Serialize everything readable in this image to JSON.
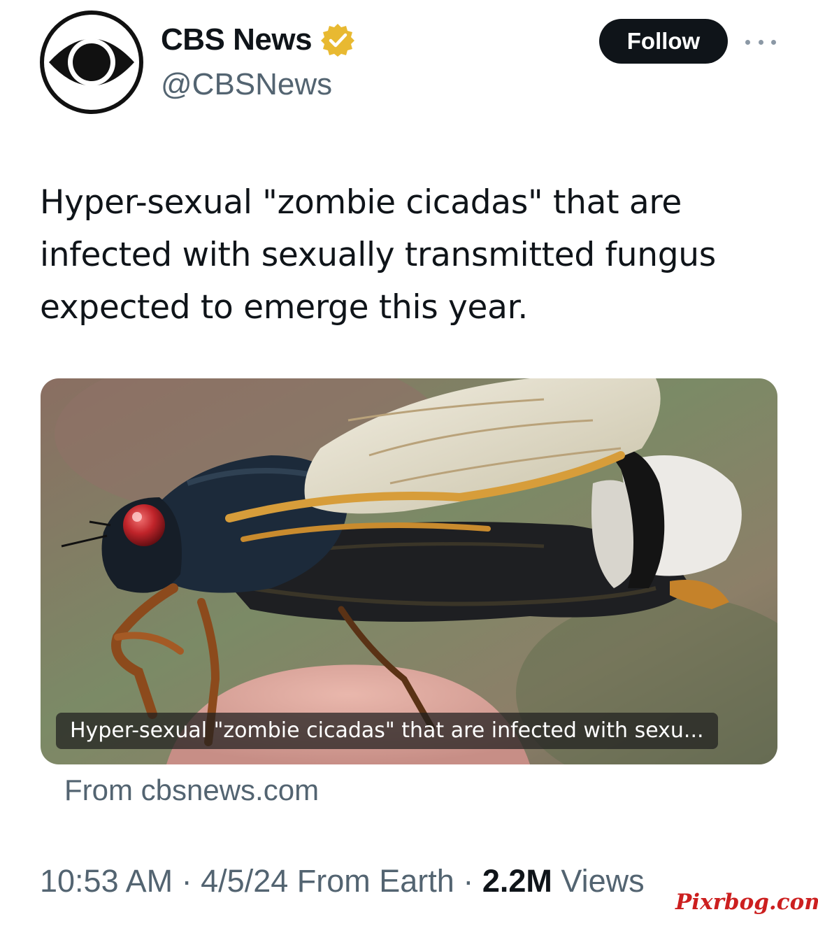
{
  "author": {
    "display_name": "CBS News",
    "handle": "@CBSNews",
    "avatar_icon": "cbs-eye-logo",
    "verified_icon": "verified-gold-badge-icon"
  },
  "actions": {
    "follow_label": "Follow",
    "more_icon": "more-dots-icon"
  },
  "tweet": {
    "text": "Hyper-sexual \"zombie cicadas\" that are infected with sexually transmitted fungus expected to emerge this year."
  },
  "link_card": {
    "image_subject": "cicada-photo",
    "caption": "Hyper-sexual \"zombie cicadas\" that are infected with sexu...",
    "source": "From cbsnews.com"
  },
  "meta": {
    "time": "10:53 AM",
    "separator": " · ",
    "date": "4/5/24",
    "origin": "From Earth",
    "views_count": "2.2M",
    "views_label": "Views"
  },
  "watermark": "Pixrbog.com",
  "colors": {
    "text_primary": "#0f1419",
    "text_secondary": "#536471",
    "follow_bg": "#0f1419",
    "verified_gold": "#e8b931",
    "watermark": "#cc1f1f"
  }
}
